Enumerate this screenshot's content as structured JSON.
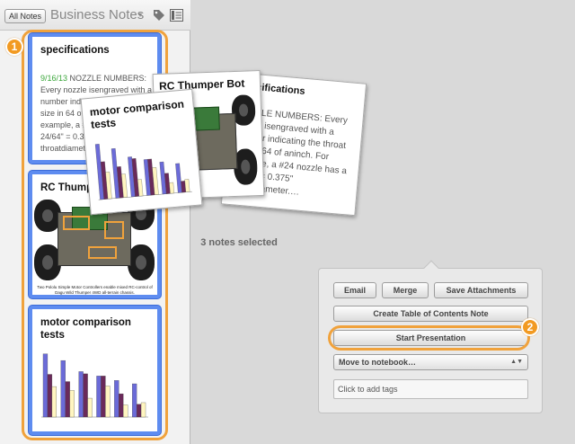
{
  "header": {
    "all_notes_label": "All Notes",
    "notebook_title": "Business Notes",
    "notebook_caret": "▾"
  },
  "badges": {
    "one": "1",
    "two": "2"
  },
  "notes": [
    {
      "title": "specifications",
      "date": "9/16/13",
      "text": " NOZZLE NUMBERS: Every nozzle isengraved with a number indicating the throat size in 64 of aninch. For example, a #24 nozzle has a 24/64\" = 0.375\" throatdiameter.…"
    },
    {
      "title": "RC Thumper Bot",
      "caption": "Two Pololu Simple Motor Controllers enable mixed RC-control of Dagu Wild Thumper 4WD all-terrain chassis."
    },
    {
      "title": "motor comparison tests"
    }
  ],
  "stack": {
    "back_title": "specifications",
    "back_text": "NOZZLE NUMBERS: Every nozzle isengraved with a number indicating the throat size in 64 of aninch. For example, a #24 nozzle has a 24/64\" = 0.375\" throatdiameter.…",
    "mid_title": "RC Thumper Bot",
    "front_title": "motor comparison tests"
  },
  "selection": {
    "count_label": "3 notes selected"
  },
  "actions": {
    "email": "Email",
    "merge": "Merge",
    "save_attachments": "Save Attachments",
    "create_toc": "Create Table of Contents Note",
    "start_presentation": "Start Presentation",
    "move_to_notebook": "Move to notebook…",
    "tags_placeholder": "Click to add tags"
  },
  "colors": {
    "selection_blue": "#5e8cf0",
    "highlight_orange": "#f0a23c",
    "date_green": "#3aa63a",
    "bar_blue": "#6b6bd8",
    "bar_purple": "#6a2a5a",
    "bar_yellow": "#fff5c0"
  },
  "chart_data": {
    "type": "bar",
    "title": "motor comparison tests",
    "series": [
      {
        "values": [
          114,
          102,
          82,
          74,
          66,
          60
        ]
      },
      {
        "values": [
          77,
          64,
          78,
          74,
          42,
          23
        ]
      },
      {
        "values": [
          55,
          48,
          34,
          56,
          22,
          26
        ]
      }
    ]
  }
}
